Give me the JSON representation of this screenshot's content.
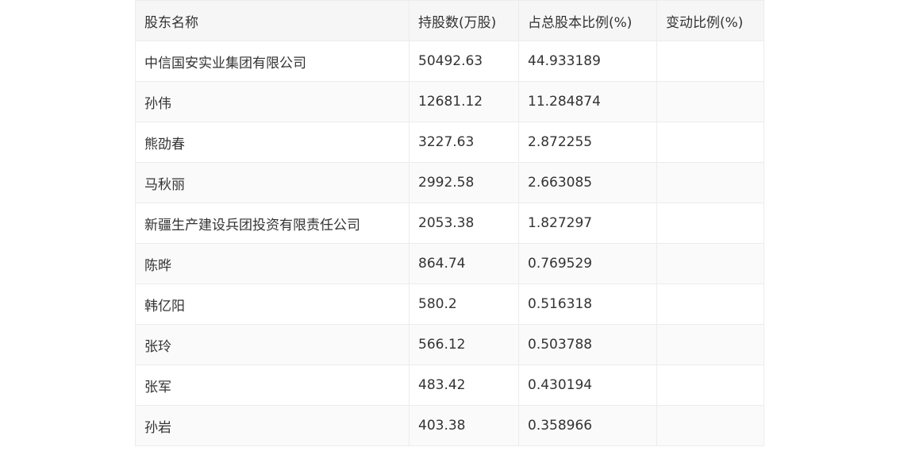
{
  "table": {
    "headers": [
      "股东名称",
      "持股数(万股)",
      "占总股本比例(%)",
      "变动比例(%)"
    ],
    "rows": [
      {
        "name": "中信国安实业集团有限公司",
        "shares": "50492.63",
        "ratio": "44.933189",
        "change": ""
      },
      {
        "name": "孙伟",
        "shares": "12681.12",
        "ratio": "11.284874",
        "change": ""
      },
      {
        "name": "熊劭春",
        "shares": "3227.63",
        "ratio": "2.872255",
        "change": ""
      },
      {
        "name": "马秋丽",
        "shares": "2992.58",
        "ratio": "2.663085",
        "change": ""
      },
      {
        "name": "新疆生产建设兵团投资有限责任公司",
        "shares": "2053.38",
        "ratio": "1.827297",
        "change": ""
      },
      {
        "name": "陈晔",
        "shares": "864.74",
        "ratio": "0.769529",
        "change": ""
      },
      {
        "name": "韩亿阳",
        "shares": "580.2",
        "ratio": "0.516318",
        "change": ""
      },
      {
        "name": "张玲",
        "shares": "566.12",
        "ratio": "0.503788",
        "change": ""
      },
      {
        "name": "张军",
        "shares": "483.42",
        "ratio": "0.430194",
        "change": ""
      },
      {
        "name": "孙岩",
        "shares": "403.38",
        "ratio": "0.358966",
        "change": ""
      }
    ]
  }
}
